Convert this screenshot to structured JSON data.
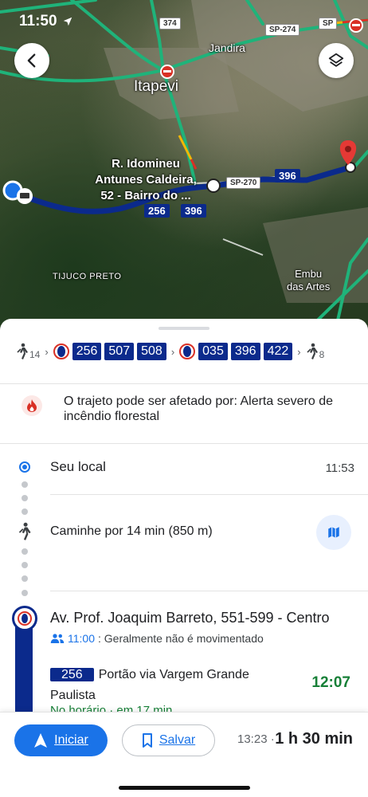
{
  "status_bar": {
    "time": "11:50"
  },
  "map": {
    "labels": {
      "city": "Itapevi",
      "district": "Jandira",
      "destination_line1": "R. Idomineu",
      "destination_line2": "Antunes Caldeira,",
      "destination_line3": "52 - Bairro do ...",
      "tijuco": "TIJUCO PRETO",
      "embu1": "Embu",
      "embu2": "das Artes"
    },
    "road_shields": {
      "r374": "374",
      "sp274": "SP-274",
      "sp270": "SP-270",
      "sp_top": "SP"
    },
    "route_badges": {
      "b256": "256",
      "b396a": "396",
      "b396b": "396"
    }
  },
  "summary": {
    "walk_start_min": "14",
    "group1": [
      "256",
      "507",
      "508"
    ],
    "group2": [
      "035",
      "396",
      "422"
    ],
    "walk_end_min": "8"
  },
  "alert": {
    "text": "O trajeto pode ser afetado por: Alerta severo de incêndio florestal"
  },
  "origin": {
    "label": "Seu local",
    "time": "11:53"
  },
  "walk_step": {
    "label": "Caminhe por 14 min (850 m)"
  },
  "stop": {
    "name": "Av. Prof. Joaquim Barreto, 551-599 - Centro",
    "crowd_time": "11:00",
    "crowd_text": ": Geralmente não é movimentado",
    "line": "256",
    "line_dest": "Portão via Vargem Grande Paulista",
    "departure": "12:07",
    "status": "No horário · em 17 min"
  },
  "bottom_bar": {
    "start_label": "Iniciar",
    "save_label": "Salvar",
    "eta": "13:23",
    "separator": "·",
    "duration": "1 h 30 min"
  },
  "colors": {
    "accent": "#1a73e8",
    "route": "#0b2a8c",
    "ontime": "#188038",
    "alert": "#d93025"
  }
}
